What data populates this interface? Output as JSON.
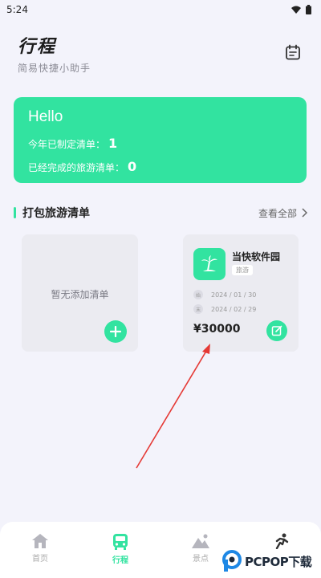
{
  "status_bar": {
    "time": "5:24",
    "icons": [
      "wifi-icon",
      "battery-icon"
    ]
  },
  "header": {
    "title": "行程",
    "subtitle": "简易快捷小助手",
    "calendar_icon": "calendar-icon"
  },
  "summary": {
    "greeting": "Hello",
    "planned_label": "今年已制定清单：",
    "planned_count": "1",
    "done_label": "已经完成的旅游清单：",
    "done_count": "0",
    "color": "#32e3a0"
  },
  "packing": {
    "title": "打包旅游清单",
    "see_all": "查看全部",
    "empty_text": "暂无添加清单",
    "trip": {
      "name": "当快软件园",
      "tag": "旅游",
      "start_label": "始",
      "start_date": "2024 / 01 / 30",
      "end_label": "末",
      "end_date": "2024 / 02 / 29",
      "price": "¥30000"
    }
  },
  "tabs": [
    {
      "label": "首页",
      "icon": "home-icon"
    },
    {
      "label": "行程",
      "icon": "bus-icon",
      "active": true
    },
    {
      "label": "景点",
      "icon": "mountain-icon"
    },
    {
      "label": "",
      "icon": "run-icon"
    }
  ],
  "watermark": {
    "text": "PCPOP下载"
  },
  "colors": {
    "accent": "#32e3a0",
    "background": "#f3f3fb",
    "arrow": "#e53935"
  }
}
